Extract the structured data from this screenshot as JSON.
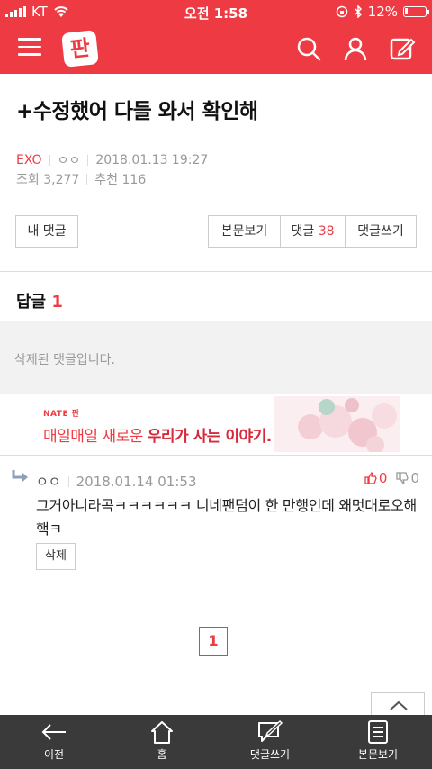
{
  "status": {
    "carrier": "KT",
    "time": "오전 1:58",
    "battery": "12%",
    "battery_level": 0.12
  },
  "post": {
    "title": "+수정했어 다들 와서 확인해",
    "category": "EXO",
    "author": "ㅇㅇ",
    "date": "2018.01.13 19:27",
    "views": "조회 3,277",
    "likes": "추천 116"
  },
  "buttons": {
    "my_comments": "내 댓글",
    "view_post": "본문보기",
    "comments_label": "댓글",
    "comments_count": "38",
    "write_comment": "댓글쓰기"
  },
  "replies": {
    "label": "답글",
    "count": "1",
    "deleted_text": "삭제된 댓글입니다."
  },
  "ad": {
    "brand": "NATE 판",
    "headline_a": "매일매일 새로운",
    "headline_b": "우리가 사는 이야기."
  },
  "comment": {
    "author": "ㅇㅇ",
    "date": "2018.01.14 01:53",
    "up": "0",
    "down": "0",
    "body": "그거아니라곡ㅋㅋㅋㅋㅋㅋ 니네팬덤이 한 만행인데 왜멋대로오해핵ㅋ",
    "delete_label": "삭제"
  },
  "pager": {
    "current": "1"
  },
  "tabbar": [
    {
      "label": "이전",
      "icon": "back-arrow-icon"
    },
    {
      "label": "홈",
      "icon": "home-icon"
    },
    {
      "label": "댓글쓰기",
      "icon": "write-comment-icon"
    },
    {
      "label": "본문보기",
      "icon": "document-icon"
    }
  ],
  "colors": {
    "brand": "#ee3b43",
    "tabbar": "#3a3a3a"
  }
}
